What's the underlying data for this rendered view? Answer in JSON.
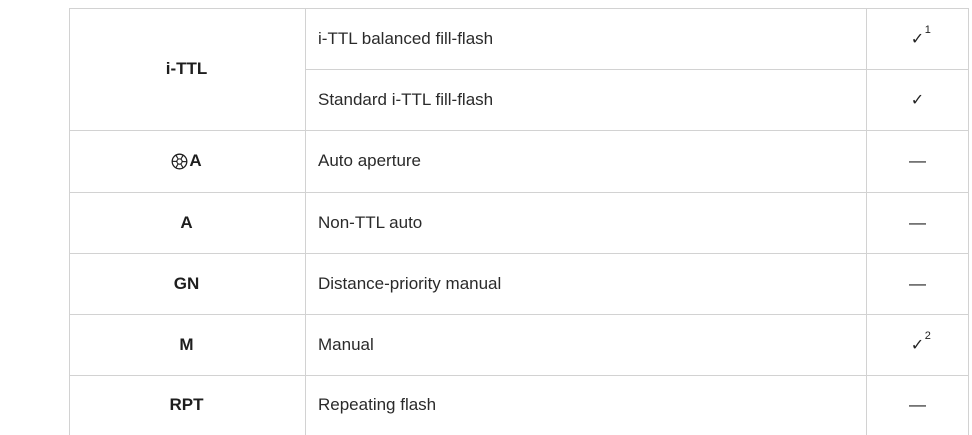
{
  "table": {
    "rows": [
      {
        "mode": "i-TTL",
        "entries": [
          {
            "description": "i-TTL balanced fill-flash",
            "support": "✓",
            "note": "1"
          },
          {
            "description": "Standard i-TTL fill-flash",
            "support": "✓",
            "note": ""
          }
        ]
      },
      {
        "mode": "A",
        "mode_icon": "auto-aperture-icon",
        "entries": [
          {
            "description": "Auto aperture",
            "support": "—",
            "note": ""
          }
        ]
      },
      {
        "mode": "A",
        "entries": [
          {
            "description": "Non-TTL auto",
            "support": "—",
            "note": ""
          }
        ]
      },
      {
        "mode": "GN",
        "entries": [
          {
            "description": "Distance-priority manual",
            "support": "—",
            "note": ""
          }
        ]
      },
      {
        "mode": "M",
        "entries": [
          {
            "description": "Manual",
            "support": "✓",
            "note": "2"
          }
        ]
      },
      {
        "mode": "RPT",
        "entries": [
          {
            "description": "Repeating flash",
            "support": "—",
            "note": ""
          }
        ]
      }
    ]
  },
  "colors": {
    "border": "#d2d2d2",
    "text": "#222222"
  }
}
